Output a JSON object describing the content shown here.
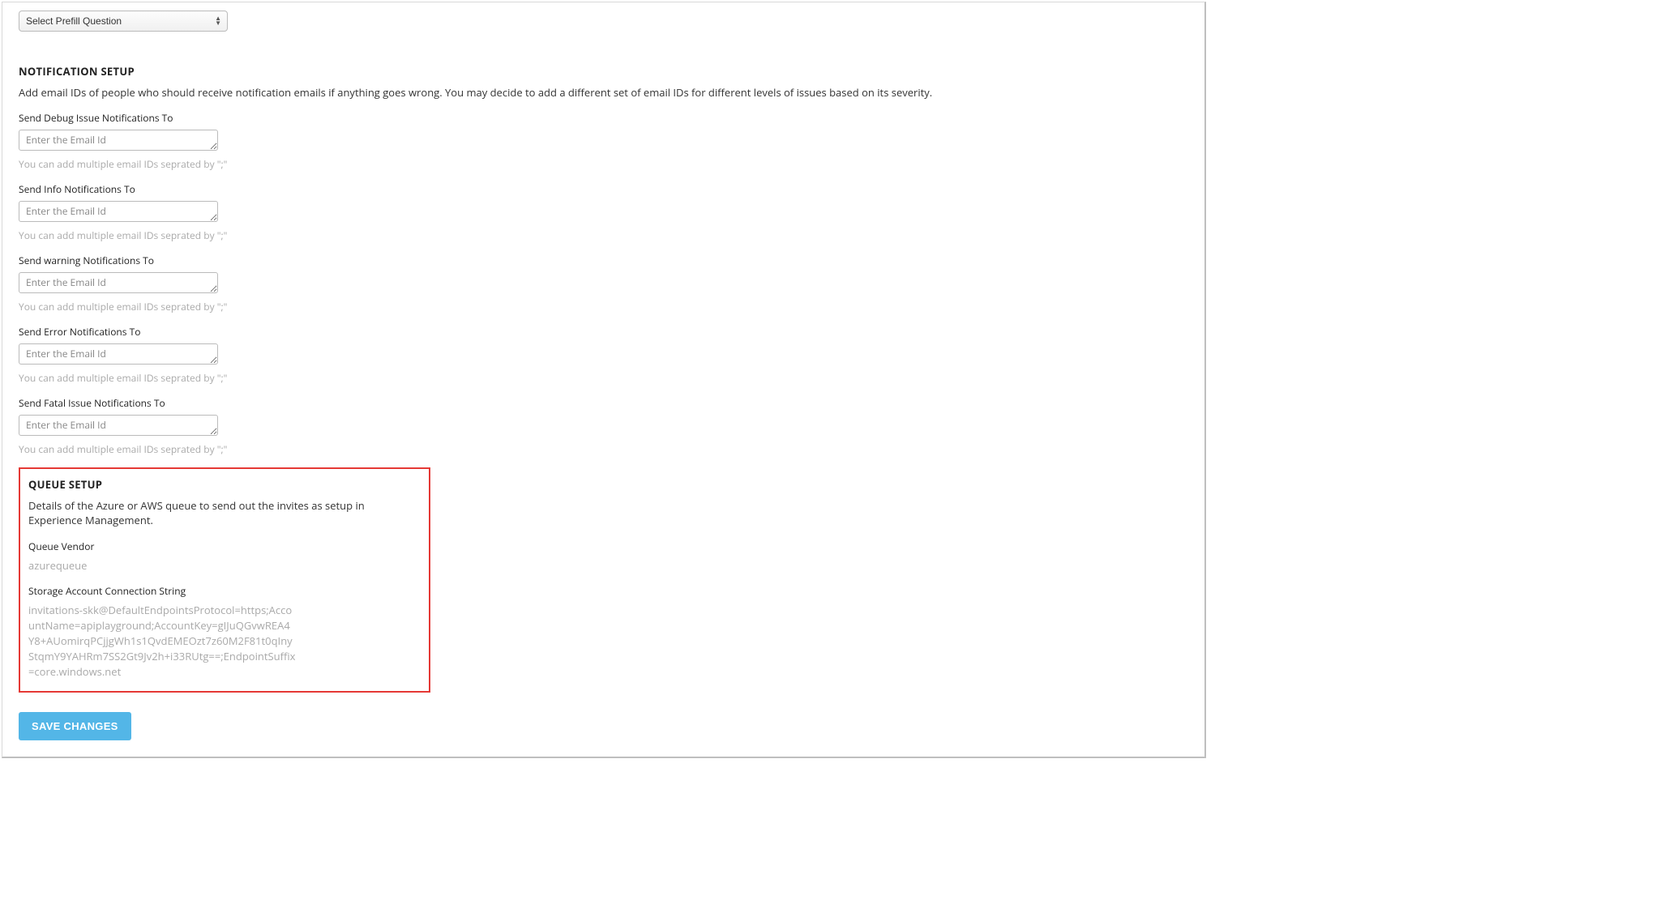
{
  "prefill_select": {
    "selected": "Select Prefill Question"
  },
  "notification_section": {
    "heading": "NOTIFICATION SETUP",
    "description": "Add email IDs of people who should receive notification emails if anything goes wrong. You may decide to add a different set of email IDs for different levels of issues based on its severity.",
    "placeholder": "Enter the Email Id",
    "help_text": "You can add multiple email IDs seprated by \";\"",
    "fields": {
      "debug": {
        "label": "Send Debug Issue Notifications To"
      },
      "info": {
        "label": "Send Info Notifications To"
      },
      "warning": {
        "label": "Send warning Notifications To"
      },
      "error": {
        "label": "Send Error Notifications To"
      },
      "fatal": {
        "label": "Send Fatal Issue Notifications To"
      }
    }
  },
  "queue_section": {
    "heading": "QUEUE SETUP",
    "description": "Details of the Azure or AWS queue to send out the invites as setup in Experience Management.",
    "vendor_label": "Queue Vendor",
    "vendor_value": "azurequeue",
    "conn_label": "Storage Account Connection String",
    "conn_value": "invitations-skk@DefaultEndpointsProtocol=https;AccountName=apiplayground;AccountKey=gIJuQGvwREA4Y8+AUomirqPCjjgWh1s1QvdEMEOzt7z60M2F81t0qInyStqmY9YAHRm7SS2Gt9Jv2h+i33RUtg==;EndpointSuffix=core.windows.net"
  },
  "save_button_label": "SAVE CHANGES"
}
